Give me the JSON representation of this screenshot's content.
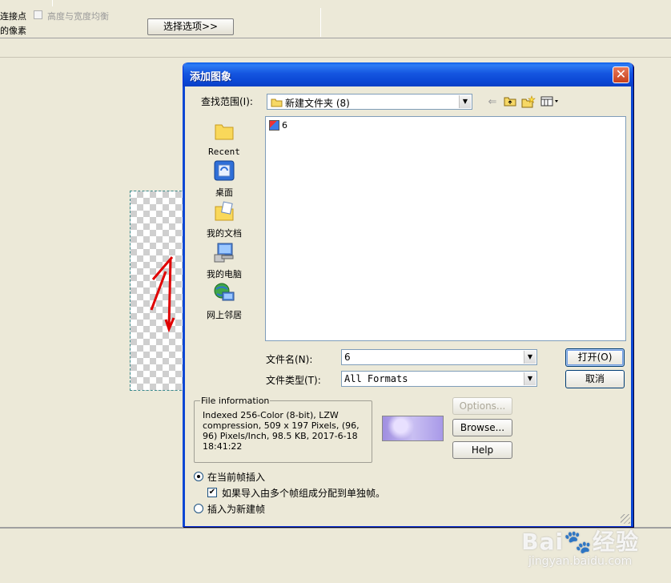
{
  "toolbar": {
    "connect_points": "连接点",
    "keep_ratio": "高度与宽度均衡",
    "pixels_label": "的像素",
    "select_options": "选择选项>>"
  },
  "dialog": {
    "title": "添加图象",
    "close_glyph": "✕",
    "look_in_label": "查找范围(I):",
    "look_in_value": "新建文件夹 (8)",
    "places": [
      {
        "label": "Recent"
      },
      {
        "label": "桌面"
      },
      {
        "label": "我的文档"
      },
      {
        "label": "我的电脑"
      },
      {
        "label": "网上邻居"
      }
    ],
    "files": [
      {
        "name": "6"
      }
    ],
    "filename_label": "文件名(N):",
    "filename_value": "6",
    "filetype_label": "文件类型(T):",
    "filetype_value": "All Formats",
    "open_button": "打开(O)",
    "cancel_button": "取消",
    "file_info_legend": "File information",
    "file_info_text": "Indexed 256-Color (8-bit), LZW compression, 509 x 197 Pixels, (96, 96) Pixels/Inch, 98.5 KB, 2017-6-18 18:41:22",
    "options_button": "Options...",
    "browse_button": "Browse...",
    "help_button": "Help",
    "insert_current": "在当前帧插入",
    "split_frames": "如果导入由多个帧组成分配到单独帧。",
    "insert_new": "插入为新建帧"
  },
  "watermark": {
    "brand": "Bai",
    "brand_cn": "经验",
    "url": "jingyan.baidu.com"
  },
  "colors": {
    "titlebar": "#0b47d4",
    "dialog_bg": "#ece9d8",
    "close": "#c7401c"
  }
}
